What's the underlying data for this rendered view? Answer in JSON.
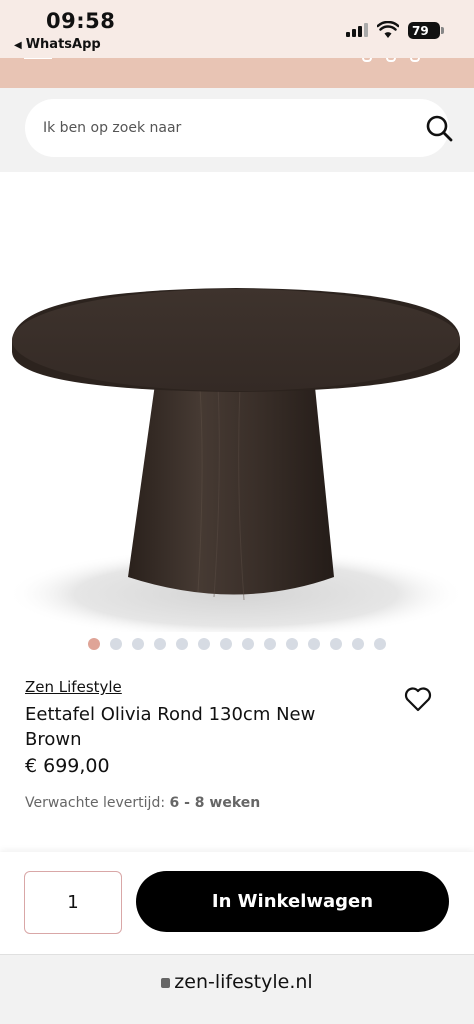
{
  "status_bar": {
    "time": "09:58",
    "back_label": "WhatsApp",
    "battery": "79"
  },
  "search": {
    "placeholder": "Ik ben op zoek naar"
  },
  "carousel": {
    "count": 14,
    "active": 0
  },
  "product": {
    "brand": "Zen Lifestyle",
    "title": "Eettafel Olivia Rond 130cm New Brown",
    "price": "€ 699,00",
    "delivery_label": "Verwachte levertijd:",
    "delivery_value": "6 - 8 weken"
  },
  "cart": {
    "quantity": "1",
    "button_label": "In Winkelwagen"
  },
  "browser": {
    "url": "zen-lifestyle.nl"
  },
  "colors": {
    "accent_header": "#e8c4b4",
    "dot_active": "#dfa497",
    "button_bg": "#000000"
  }
}
